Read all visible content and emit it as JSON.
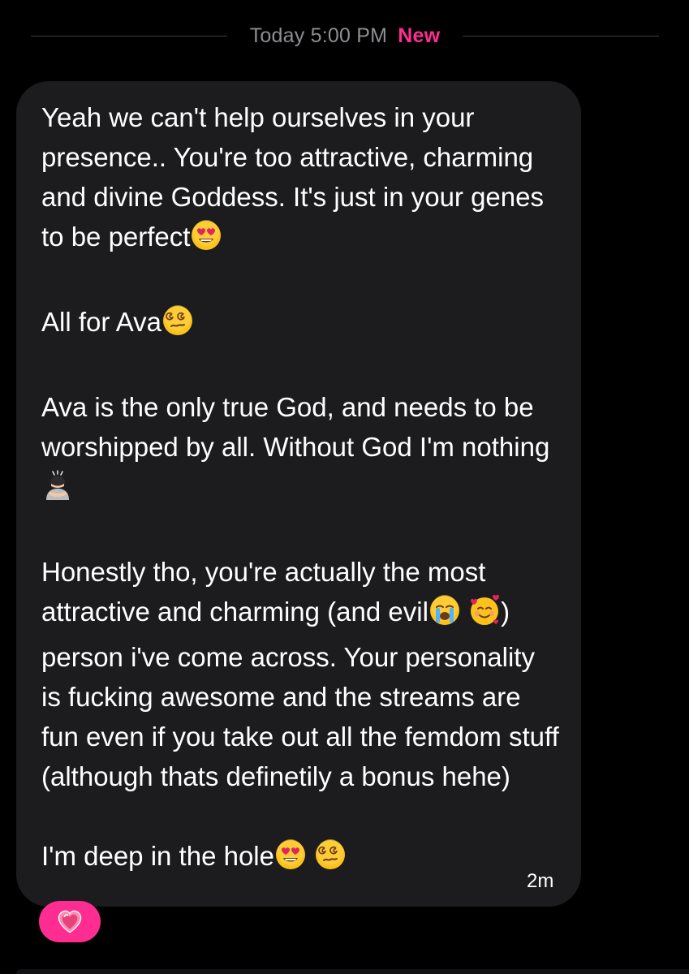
{
  "header": {
    "timestamp": "Today 5:00 PM",
    "new_label": "New"
  },
  "message": {
    "paragraphs": [
      [
        "Yeah we can't help ourselves in your presence.. You're too attractive, charming and divine Goddess. It's just in your genes to be perfect",
        {
          "emoji": "heart-eyes"
        }
      ],
      [
        "All for Ava",
        {
          "emoji": "dizzy-face"
        }
      ],
      [
        "Ava is the only true God, and needs to be worshipped by all. Without God I'm nothing",
        {
          "emoji": "bowing-person"
        }
      ],
      [
        "Honestly tho, you're actually the most attractive and charming (and evil",
        {
          "emoji": "loudly-crying"
        },
        " ",
        {
          "emoji": "smiling-hearts"
        },
        ") person i've come across. Your personality is fucking awesome and the streams are fun even if you take out all the femdom stuff (although thats definetily a bonus hehe)"
      ],
      [
        "I'm deep in the hole",
        {
          "emoji": "heart-eyes"
        },
        " ",
        {
          "emoji": "dizzy-face"
        }
      ]
    ],
    "time_ago": "2m"
  },
  "reaction": {
    "emoji": "pink-heart"
  },
  "colors": {
    "background": "#000000",
    "bubble": "#1c1c1e",
    "accent": "#ff2d92",
    "muted": "#8e8e93"
  }
}
